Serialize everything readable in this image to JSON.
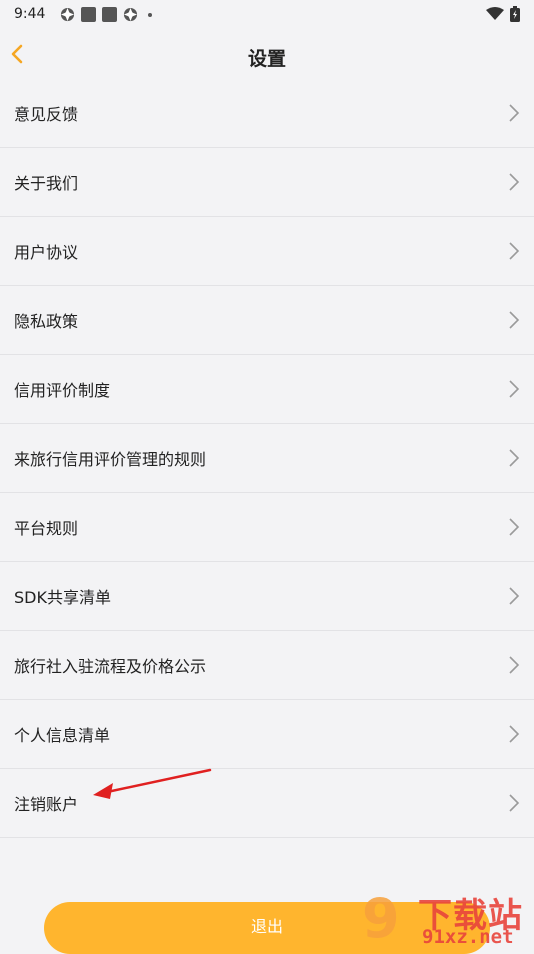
{
  "status": {
    "time": "9:44"
  },
  "header": {
    "title": "设置"
  },
  "menu": [
    {
      "id": "feedback",
      "label": "意见反馈"
    },
    {
      "id": "about",
      "label": "关于我们"
    },
    {
      "id": "agreement",
      "label": "用户协议"
    },
    {
      "id": "privacy",
      "label": "隐私政策"
    },
    {
      "id": "credit-system",
      "label": "信用评价制度"
    },
    {
      "id": "credit-rules",
      "label": "来旅行信用评价管理的规则"
    },
    {
      "id": "platform-rules",
      "label": "平台规则"
    },
    {
      "id": "sdk-list",
      "label": "SDK共享清单"
    },
    {
      "id": "agency-process",
      "label": "旅行社入驻流程及价格公示"
    },
    {
      "id": "personal-info",
      "label": "个人信息清单"
    },
    {
      "id": "cancel-account",
      "label": "注销账户"
    }
  ],
  "footer": {
    "logout_label": "退出"
  },
  "watermark": {
    "title": "下载站",
    "url": "91xz.net"
  },
  "colors": {
    "accent": "#ffb52e",
    "back_arrow": "#f5a623",
    "annotation": "#e02020"
  }
}
